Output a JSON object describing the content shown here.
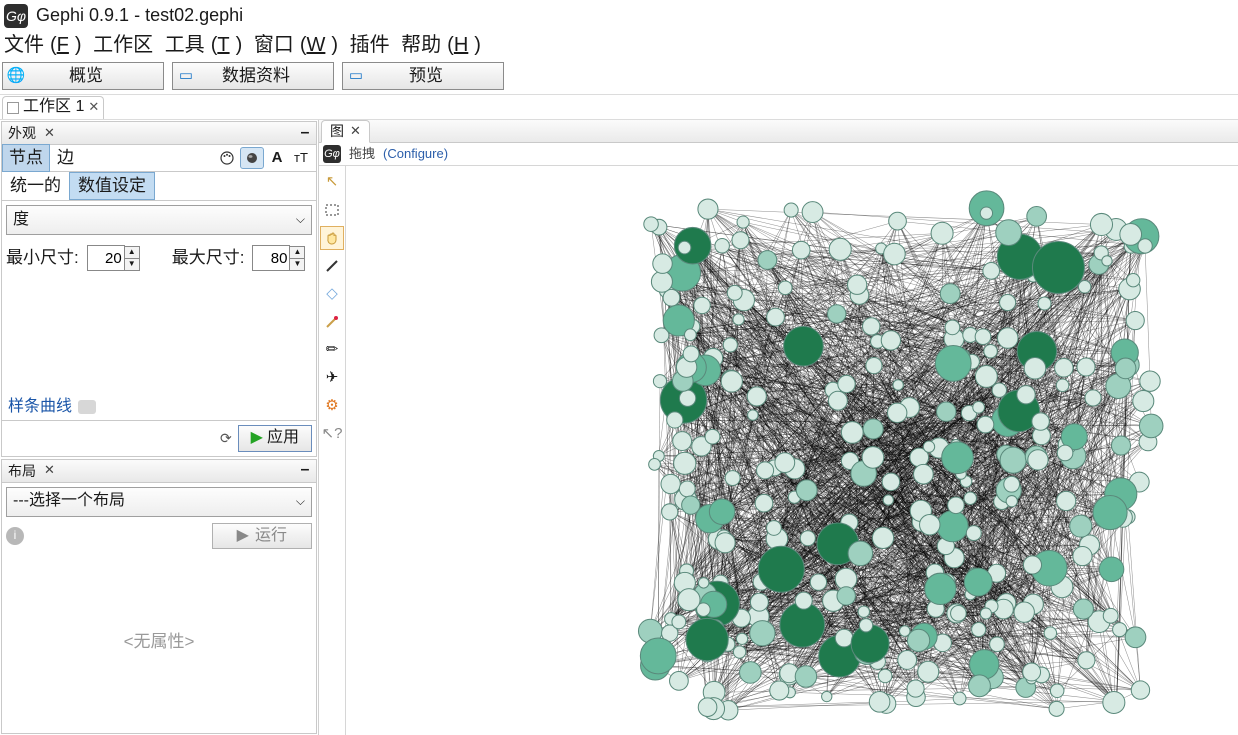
{
  "title": "Gephi 0.9.1 - test02.gephi",
  "menu": {
    "file": "文件",
    "file_k": "F",
    "ws": "工作区",
    "tools": "工具",
    "tools_k": "T",
    "window": "窗口",
    "window_k": "W",
    "plugin": "插件",
    "help": "帮助",
    "help_k": "H"
  },
  "maintabs": {
    "overview": "概览",
    "data": "数据资料",
    "preview": "预览"
  },
  "workspace_tab": "工作区 1",
  "panels": {
    "appearance": "外观",
    "layout": "布局",
    "graph": "图"
  },
  "appearance": {
    "tabs": {
      "nodes": "节点",
      "edges": "边"
    },
    "subtabs": {
      "unique": "统一的",
      "ranking": "数值设定"
    },
    "attr": "度",
    "min_label": "最小尺寸:",
    "min": "20",
    "max_label": "最大尺寸:",
    "max": "80",
    "spline": "样条曲线",
    "apply": "应用"
  },
  "layout": {
    "placeholder": "---选择一个布局",
    "run": "运行",
    "noprops": "<无属性>"
  },
  "graph": {
    "drag": "拖拽",
    "configure": "(Configure)"
  },
  "vtools": {
    "pointer": "↖",
    "select": "▭",
    "hand": "✋",
    "brush": "／",
    "diamond": "◇",
    "wand": "✎",
    "pen": "✏",
    "plane": "✈",
    "gear": "⚙",
    "help": "?"
  },
  "icons": {
    "palette": "🎨",
    "sphere": "◉",
    "font": "A",
    "size": "тT",
    "globe": "🌐",
    "monitor": "▭"
  }
}
